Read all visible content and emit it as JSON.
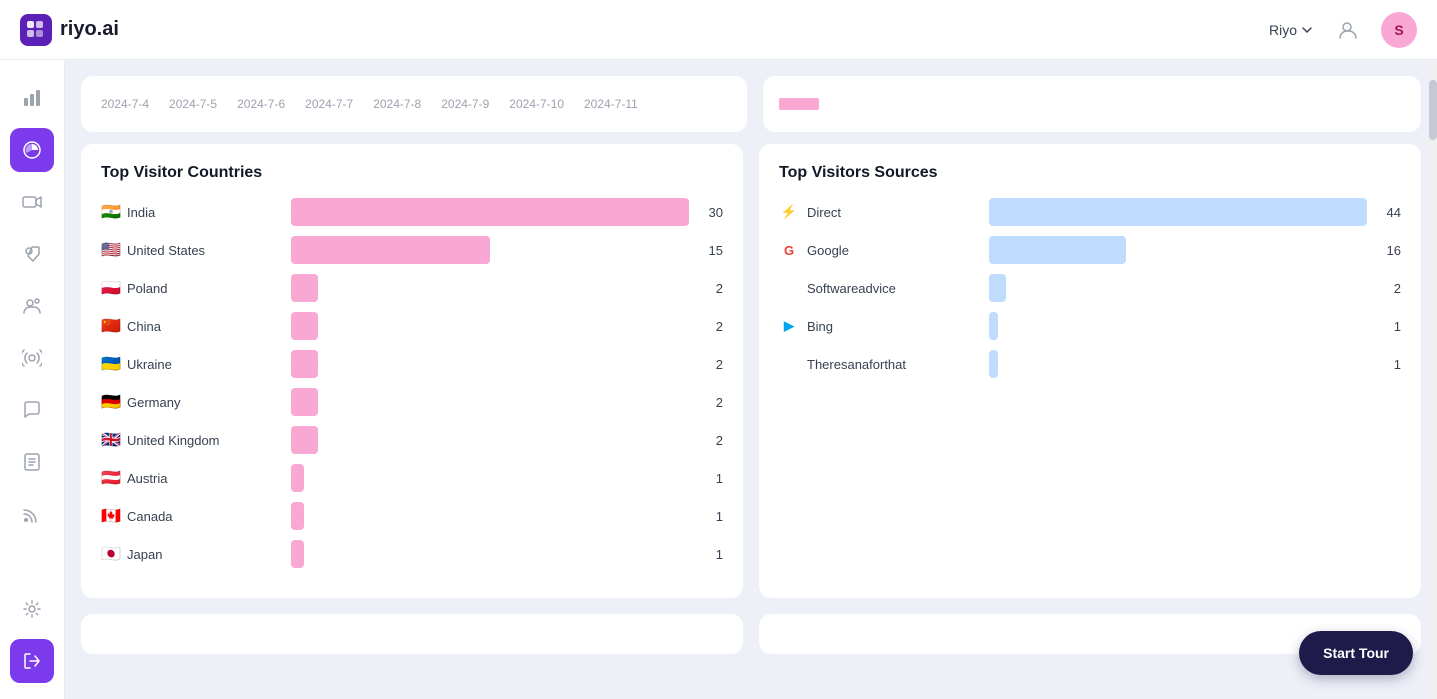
{
  "header": {
    "logo_text": "riyo.ai",
    "user_name": "Riyo",
    "user_initial": "S"
  },
  "sidebar": {
    "items": [
      {
        "id": "analytics",
        "icon": "📊",
        "active": false,
        "label": "Analytics"
      },
      {
        "id": "chart-pie",
        "icon": "📈",
        "active": true,
        "label": "Reports"
      },
      {
        "id": "video",
        "icon": "🎥",
        "active": false,
        "label": "Video"
      },
      {
        "id": "user-tag",
        "icon": "🏷",
        "active": false,
        "label": "Tags"
      },
      {
        "id": "users",
        "icon": "👥",
        "active": false,
        "label": "Users"
      },
      {
        "id": "broadcast",
        "icon": "📡",
        "active": false,
        "label": "Broadcast"
      },
      {
        "id": "chat",
        "icon": "💬",
        "active": false,
        "label": "Chat"
      },
      {
        "id": "notes",
        "icon": "📋",
        "active": false,
        "label": "Notes"
      },
      {
        "id": "rss",
        "icon": "📰",
        "active": false,
        "label": "Feed"
      },
      {
        "id": "settings",
        "icon": "⚙",
        "active": false,
        "label": "Settings"
      }
    ],
    "logout_label": "Logout"
  },
  "dates_bar": {
    "dates": [
      "2024-7-4",
      "2024-7-5",
      "2024-7-6",
      "2024-7-7",
      "2024-7-8",
      "2024-7-9",
      "2024-7-10",
      "2024-7-11"
    ]
  },
  "top_visitor_countries": {
    "title": "Top Visitor Countries",
    "countries": [
      {
        "name": "India",
        "flag": "🇮🇳",
        "count": 30,
        "pct": 100
      },
      {
        "name": "United States",
        "flag": "🇺🇸",
        "count": 15,
        "pct": 50
      },
      {
        "name": "Poland",
        "flag": "🇵🇱",
        "count": 2,
        "pct": 7
      },
      {
        "name": "China",
        "flag": "🇨🇳",
        "count": 2,
        "pct": 7
      },
      {
        "name": "Ukraine",
        "flag": "🇺🇦",
        "count": 2,
        "pct": 7
      },
      {
        "name": "Germany",
        "flag": "🇩🇪",
        "count": 2,
        "pct": 7
      },
      {
        "name": "United Kingdom",
        "flag": "🇬🇧",
        "count": 2,
        "pct": 7
      },
      {
        "name": "Austria",
        "flag": "🇦🇹",
        "count": 1,
        "pct": 3
      },
      {
        "name": "Canada",
        "flag": "🇨🇦",
        "count": 1,
        "pct": 3
      },
      {
        "name": "Japan",
        "flag": "🇯🇵",
        "count": 1,
        "pct": 3
      }
    ]
  },
  "top_visitor_sources": {
    "title": "Top Visitors Sources",
    "sources": [
      {
        "name": "Direct",
        "icon": "⚡",
        "icon_color": "#3b82f6",
        "count": 44,
        "pct": 100
      },
      {
        "name": "Google",
        "icon": "G",
        "icon_color": "#ea4335",
        "count": 16,
        "pct": 36
      },
      {
        "name": "Softwareadvice",
        "icon": "",
        "icon_color": "",
        "count": 2,
        "pct": 5
      },
      {
        "name": "Bing",
        "icon": "▶",
        "icon_color": "#00a4ef",
        "count": 1,
        "pct": 2
      },
      {
        "name": "Theresanaforthat",
        "icon": "",
        "icon_color": "",
        "count": 1,
        "pct": 2
      }
    ]
  },
  "start_tour": {
    "label": "Start Tour"
  }
}
